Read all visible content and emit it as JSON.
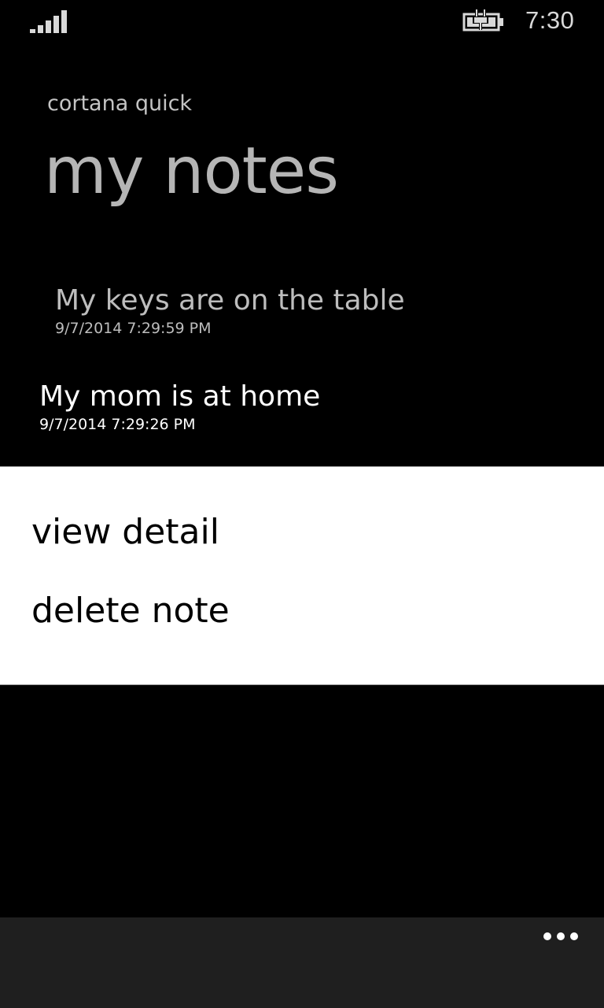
{
  "status_bar": {
    "time": "7:30",
    "signal_icon": "signal-strength-icon",
    "battery_icon": "battery-charging-icon"
  },
  "header": {
    "app_name": "cortana quick",
    "page_title": "my notes"
  },
  "notes": [
    {
      "title": "My keys are on the table",
      "timestamp": "9/7/2014 7:29:59 PM"
    },
    {
      "title": "My mom is at home",
      "timestamp": "9/7/2014 7:29:26 PM"
    }
  ],
  "context_menu": {
    "items": [
      {
        "label": "view detail"
      },
      {
        "label": "delete note"
      }
    ]
  },
  "app_bar": {
    "more_icon": "ellipsis-icon"
  },
  "colors": {
    "background": "#000000",
    "menu_background": "#ffffff",
    "app_bar": "#1f1f1f"
  }
}
